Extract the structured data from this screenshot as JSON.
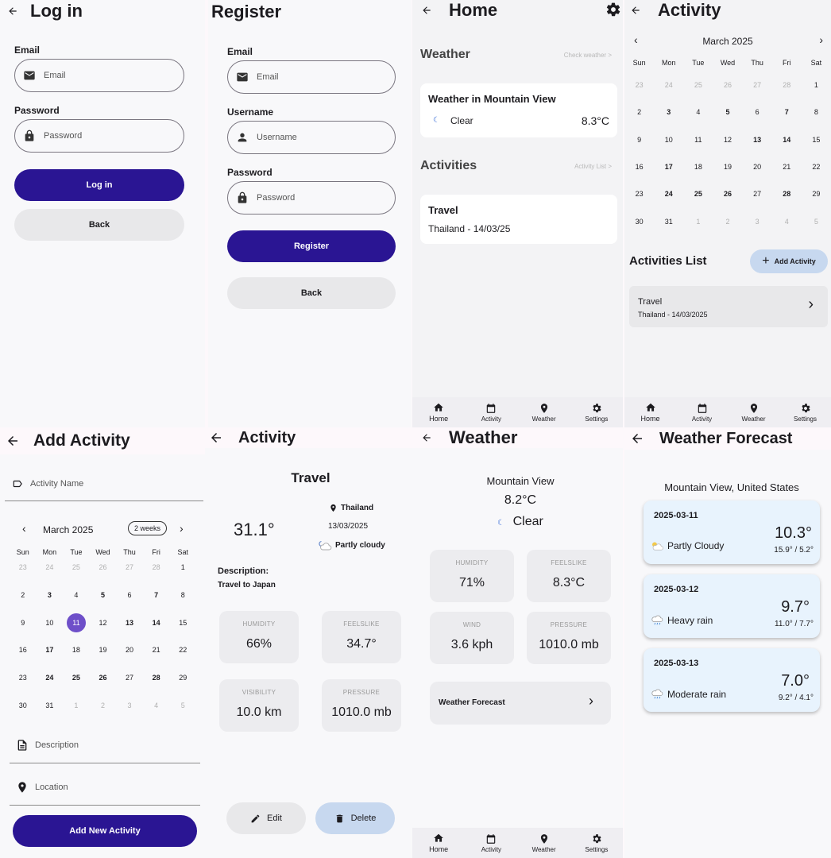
{
  "login": {
    "title": "Log in",
    "email_label": "Email",
    "email_placeholder": "Email",
    "password_label": "Password",
    "password_placeholder": "Password",
    "login_button": "Log in",
    "back_button": "Back"
  },
  "register": {
    "title": "Register",
    "email_label": "Email",
    "email_placeholder": "Email",
    "username_label": "Username",
    "username_placeholder": "Username",
    "password_label": "Password",
    "password_placeholder": "Password",
    "register_button": "Register",
    "back_button": "Back"
  },
  "home": {
    "title": "Home",
    "weather_section": "Weather",
    "check_weather_link": "Check weather >",
    "weather_card_title": "Weather in Mountain View",
    "weather_condition": "Clear",
    "weather_temp": "8.3°C",
    "activities_section": "Activities",
    "activity_list_link": "Activity List >",
    "activity_title": "Travel",
    "activity_subtitle": "Thailand - 14/03/25"
  },
  "nav": {
    "home": "Home",
    "activity": "Activity",
    "weather": "Weather",
    "settings": "Settings"
  },
  "activity_cal": {
    "title": "Activity",
    "month": "March 2025",
    "weekdays": [
      "Sun",
      "Mon",
      "Tue",
      "Wed",
      "Thu",
      "Fri",
      "Sat"
    ],
    "days": [
      "23",
      "24",
      "25",
      "26",
      "27",
      "28",
      "1",
      "2",
      "3",
      "4",
      "5",
      "6",
      "7",
      "8",
      "9",
      "10",
      "11",
      "12",
      "13",
      "14",
      "15",
      "16",
      "17",
      "18",
      "19",
      "20",
      "21",
      "22",
      "23",
      "24",
      "25",
      "26",
      "27",
      "28",
      "29",
      "30",
      "31",
      "1",
      "2",
      "3",
      "4",
      "5"
    ],
    "list_title": "Activities List",
    "add_button": "Add Activity",
    "item_title": "Travel",
    "item_subtitle": "Thailand - 14/03/2025"
  },
  "add_activity": {
    "title": "Add Activity",
    "name_placeholder": "Activity Name",
    "month": "March 2025",
    "format_chip": "2 weeks",
    "weekdays": [
      "Sun",
      "Mon",
      "Tue",
      "Wed",
      "Thu",
      "Fri",
      "Sat"
    ],
    "days": [
      "23",
      "24",
      "25",
      "26",
      "27",
      "28",
      "1",
      "2",
      "3",
      "4",
      "5",
      "6",
      "7",
      "8",
      "9",
      "10",
      "11",
      "12",
      "13",
      "14",
      "15",
      "16",
      "17",
      "18",
      "19",
      "20",
      "21",
      "22",
      "23",
      "24",
      "25",
      "26",
      "27",
      "28",
      "29",
      "30",
      "31",
      "1",
      "2",
      "3",
      "4",
      "5"
    ],
    "selected_day": "11",
    "description_placeholder": "Description",
    "location_placeholder": "Location",
    "submit_button": "Add New Activity"
  },
  "activity_detail": {
    "title": "Activity",
    "name": "Travel",
    "temp": "31.1°",
    "location": "Thailand",
    "date": "13/03/2025",
    "condition": "Partly cloudy",
    "description_label": "Description:",
    "description": "Travel to Japan",
    "humidity_label": "HUMIDITY",
    "humidity": "66%",
    "feelslike_label": "FEELSLIKE",
    "feelslike": "34.7°",
    "visibility_label": "VISIBILITY",
    "visibility": "10.0 km",
    "pressure_label": "PRESSURE",
    "pressure": "1010.0 mb",
    "edit_button": "Edit",
    "delete_button": "Delete"
  },
  "weather": {
    "title": "Weather",
    "city": "Mountain View",
    "temp": "8.2°C",
    "condition": "Clear",
    "humidity_label": "HUMIDITY",
    "humidity": "71%",
    "feelslike_label": "FEELSLIKE",
    "feelslike": "8.3°C",
    "wind_label": "WIND",
    "wind": "3.6 kph",
    "pressure_label": "PRESSURE",
    "pressure": "1010.0 mb",
    "forecast_link": "Weather Forecast"
  },
  "forecast": {
    "title": "Weather Forecast",
    "location": "Mountain View, United States",
    "days": [
      {
        "date": "2025-03-11",
        "temp": "10.3°",
        "condition": "Partly Cloudy",
        "range": "15.9° / 5.2°",
        "icon": "partly-cloudy-icon"
      },
      {
        "date": "2025-03-12",
        "temp": "9.7°",
        "condition": "Heavy rain",
        "range": "11.0° / 7.7°",
        "icon": "rain-icon"
      },
      {
        "date": "2025-03-13",
        "temp": "7.0°",
        "condition": "Moderate rain",
        "range": "9.2° / 4.1°",
        "icon": "rain-icon"
      }
    ]
  },
  "colors": {
    "primary": "#2a1593",
    "secondary_button": "#e8e8ea",
    "add_button": "#c7d8ef",
    "selected_day": "#6e4fc9",
    "forecast_card": "#e8f3fd"
  }
}
